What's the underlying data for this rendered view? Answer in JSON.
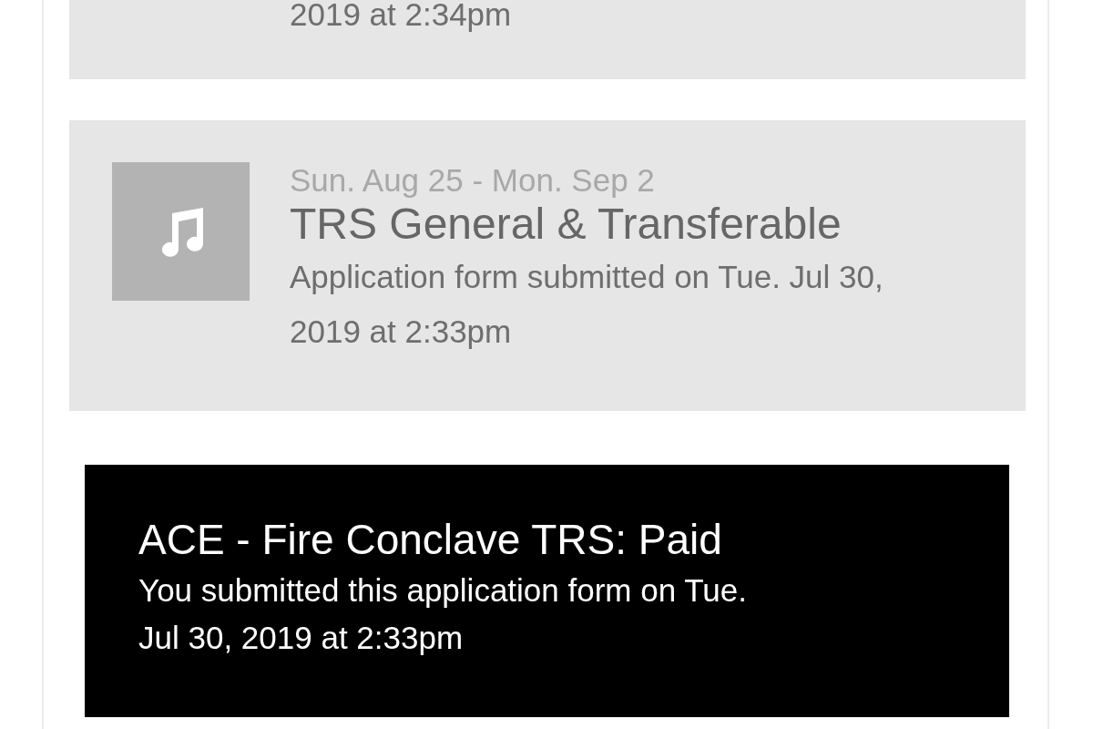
{
  "events": [
    {
      "kind": "partial",
      "description": "2019 at 2:34pm"
    },
    {
      "kind": "event",
      "dates": "Sun. Aug 25 - Mon. Sep 2",
      "title": "TRS General & Transferable",
      "description": "Application form submitted on Tue. Jul 30, 2019 at 2:33pm"
    }
  ],
  "notice": {
    "title": "ACE - Fire Conclave TRS: Paid",
    "message": "You submitted this application form on Tue. Jul 30, 2019 at 2:33pm"
  }
}
